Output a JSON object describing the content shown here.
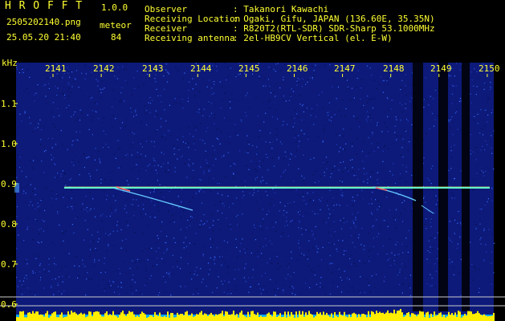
{
  "header": {
    "app_name": "H R O F F T",
    "version": "1.0.0",
    "filename": "2505202140.png",
    "datetime": "25.05.20 21:40",
    "detection_label": "meteor",
    "detection_count": "84",
    "info_rows": [
      {
        "label": "Observer",
        "value": ": Takanori Kawachi"
      },
      {
        "label": "Receiving Location",
        "value": ": Ogaki, Gifu, JAPAN (136.60E, 35.35N)"
      },
      {
        "label": "Receiver",
        "value": ": R820T2(RTL-SDR) SDR-Sharp 53.1000MHz"
      },
      {
        "label": "Receiving antenna",
        "value": ": 2el-HB9CV Vertical (el. E-W)"
      }
    ]
  },
  "spectrogram": {
    "y_unit": "kHz",
    "y_ticks": [
      "1.1",
      "1.0",
      "0.9",
      "0.8",
      "0.7",
      "0.6"
    ],
    "y_tick_values": [
      1.1,
      1.0,
      0.9,
      0.8,
      0.7,
      0.6
    ],
    "x_ticks": [
      "2141",
      "2142",
      "2143",
      "2144",
      "2145",
      "2146",
      "2147",
      "2148",
      "2149",
      "2150"
    ],
    "carrier_khz": 0.89,
    "colors": {
      "background": "#000000",
      "noise": "#0d1a7a",
      "carrier": "#66ffcc",
      "meteor": "#66ccff",
      "level_bar": "#ffee00",
      "level_base": "#00aaff",
      "gridline": "#cccccc",
      "text": "#ffff33"
    }
  }
}
